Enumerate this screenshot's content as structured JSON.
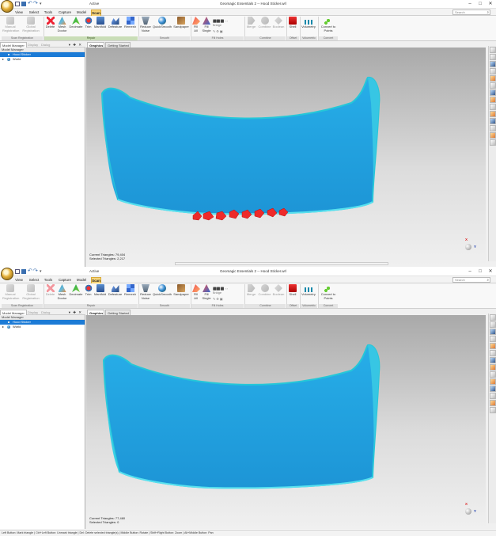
{
  "colors": {
    "accent": "#1c7bd6",
    "scan_tab": "#f6d478",
    "mesh_fill": "#1f9fe0",
    "mesh_edge": "#25c7d8",
    "selection": "#ee2a2a"
  },
  "window": {
    "title": "Geomagic Essentials 2 -- Hood Sticker.wrl",
    "context_label": "Active",
    "controls": {
      "minimize": "–",
      "maximize": "□",
      "close": "✕"
    },
    "search_placeholder": "Search"
  },
  "ribbon": {
    "tabs": [
      "View",
      "Select",
      "Tools",
      "Capture",
      "Model",
      "Scan"
    ],
    "active_tab": "Scan",
    "buttons": {
      "manual_registration": "Manual\nRegistration",
      "global_registration": "Global\nRegistration",
      "delete": "Delete",
      "mesh_doctor": "Mesh\nDoctor",
      "decimate": "Decimate",
      "trim": "Trim",
      "manifold": "Manifold",
      "defeature": "Defeature",
      "remesh": "Remesh",
      "reduce_noise": "Reduce\nNoise",
      "quicksmooth": "QuickSmooth",
      "sandpaper": "Sandpaper",
      "fill_all": "Fill\nAll",
      "fill_single": "Fill\nSingle",
      "bridge": "Bridge",
      "merge": "Merge",
      "combine": "Combine",
      "boolean": "Boolean",
      "shell": "Shell",
      "volumetry": "Volumetry",
      "convert_to_points": "Convert to\nPoints"
    },
    "groups": {
      "scan_registration": "Scan Registration",
      "repair": "Repair",
      "smooth": "Smooth",
      "fill_holes": "Fill Holes",
      "combine": "Combine",
      "offset": "Offset",
      "volumetric": "Volumetric",
      "convert": "Convert"
    }
  },
  "model_manager": {
    "tabs": [
      "Model Manager",
      "Display",
      "Dialog"
    ],
    "controls": "▾ ✚ ✕",
    "title": "Model Manager",
    "items": [
      "Hood Sticker",
      "World"
    ]
  },
  "graphics": {
    "tabs": [
      "Graphics",
      "Getting Started"
    ]
  },
  "views": [
    {
      "current_triangles": "Current Triangles: 79,404",
      "selected_triangles": "Selected Triangles: 2,217"
    },
    {
      "current_triangles": "Current Triangles: 77,460",
      "selected_triangles": "Selected Triangles: 0"
    }
  ],
  "axis": {
    "x": "X",
    "y": "Y"
  },
  "statusbar": "Left Button: Mark triangle | Ctrl+Left Button: Unmark triangle | Del: Delete selected triangle(s) | Middle Button: Rotate | Shift+Right Button: Zoom | Alt+Middle Button: Pan"
}
